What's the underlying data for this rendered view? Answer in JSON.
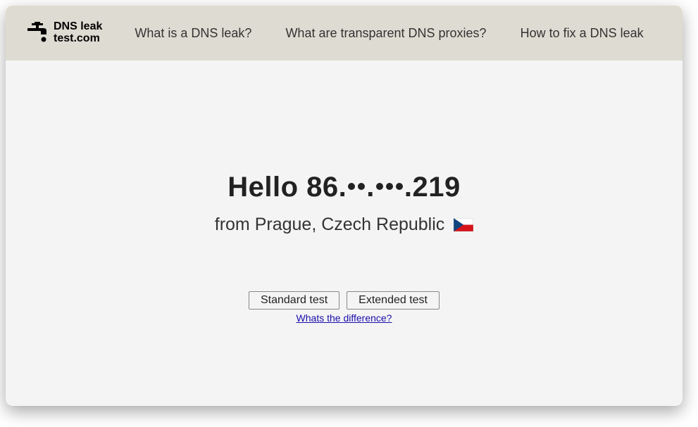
{
  "logo": {
    "line1": "DNS leak",
    "line2": "test.com"
  },
  "nav": {
    "what_is": "What is a DNS leak?",
    "transparent": "What are transparent DNS proxies?",
    "howto": "How to fix a DNS leak"
  },
  "main": {
    "hello_prefix": "Hello ",
    "ip_part1": "86.",
    "ip_sep1": ".",
    "ip_sep2": ".219",
    "from_prefix": "from ",
    "location": "Prague, Czech Republic",
    "flag_name": "flag-czech-republic",
    "buttons": {
      "standard": "Standard test",
      "extended": "Extended test"
    },
    "diff_link": "Whats the difference?"
  }
}
